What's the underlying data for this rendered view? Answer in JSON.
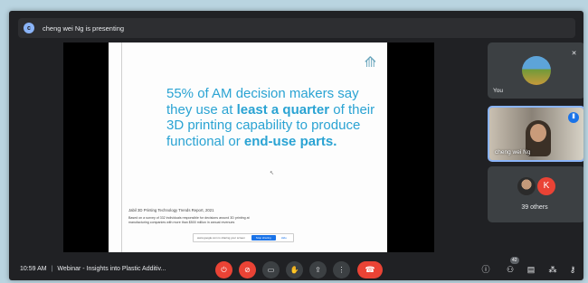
{
  "presenting": {
    "avatar_letter": "c",
    "text": "cheng wei Ng is presenting"
  },
  "slide": {
    "headline_parts": [
      "55% of AM decision makers say they use at ",
      "least a quarter",
      " of their 3D printing capability to produce functional or ",
      "end-use parts."
    ],
    "source": "Jabil 3D Printing Technology Trends Report, 2021",
    "note": "Based on a survey of 332 individuals responsible for decisions around 3D printing at manufacturing companies with more than $500 million in annual revenues",
    "share_text": "www.google.com is sharing your screen",
    "share_stop": "Stop sharing",
    "share_hide": "Hide"
  },
  "tiles": {
    "you": {
      "name": "You"
    },
    "presenter": {
      "name": "cheng wei Ng"
    },
    "others": {
      "avatar_letter": "K",
      "label": "39 others"
    }
  },
  "bottom": {
    "time": "10:59 AM",
    "meeting_title": "Webinar - Insights into Plastic Additiv...",
    "participant_count": "42"
  },
  "colors": {
    "accent": "#2aa3d3",
    "danger": "#ea4335",
    "bar_bg": "#202124"
  },
  "icons": [
    "mic-off-icon",
    "camera-off-icon",
    "captions-icon",
    "raise-hand-icon",
    "present-screen-icon",
    "more-options-icon",
    "end-call-icon",
    "info-icon",
    "people-icon",
    "chat-icon",
    "activities-icon",
    "host-controls-icon"
  ]
}
